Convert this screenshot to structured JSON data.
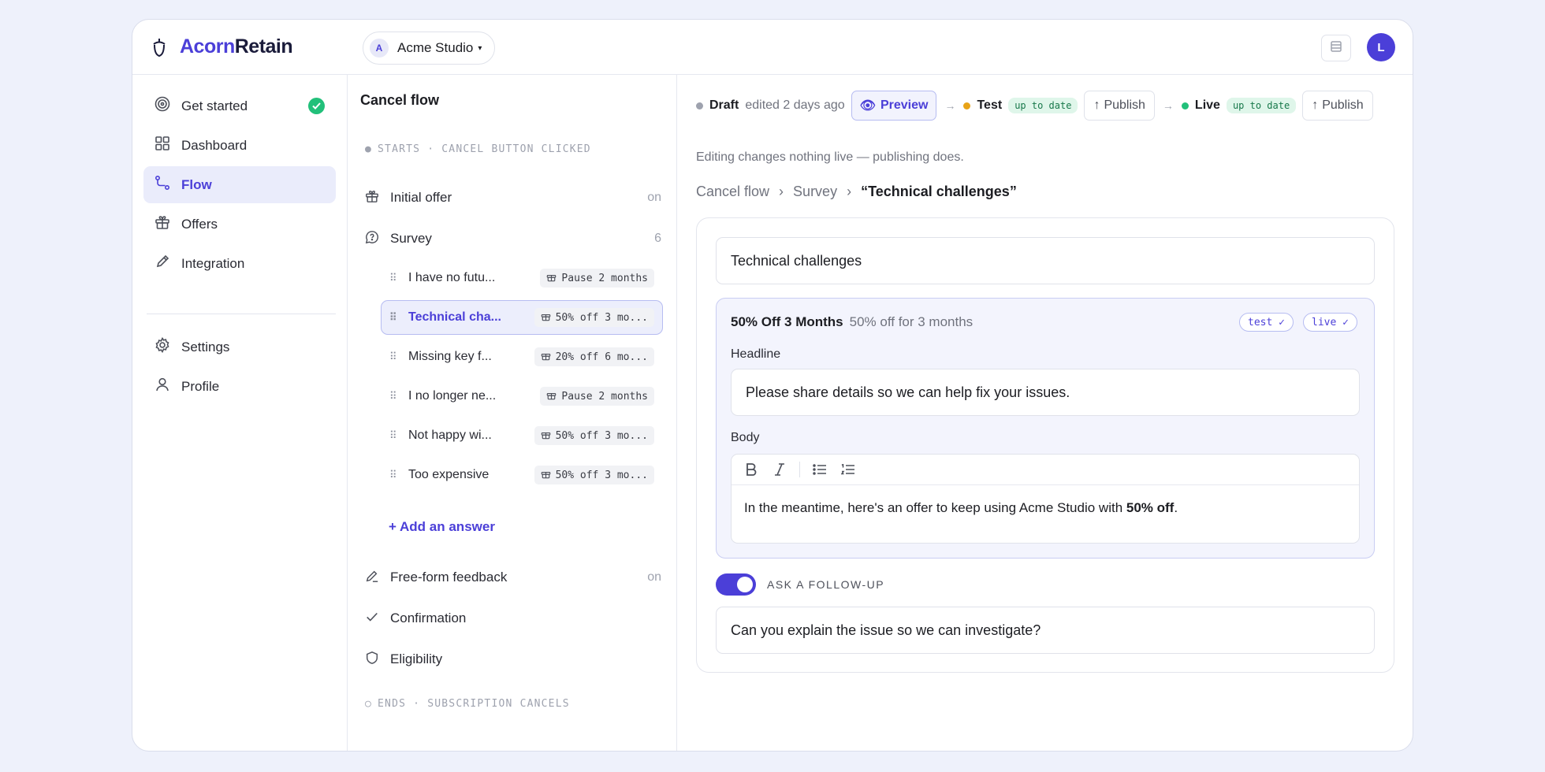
{
  "header": {
    "logo_part1": "Acorn",
    "logo_part2": "Retain",
    "workspace_initial": "A",
    "workspace_name": "Acme Studio",
    "user_initial": "L"
  },
  "sidebar": {
    "items": [
      {
        "label": "Get started",
        "icon": "target-icon",
        "completed": true
      },
      {
        "label": "Dashboard",
        "icon": "grid-icon"
      },
      {
        "label": "Flow",
        "icon": "flow-icon",
        "active": true
      },
      {
        "label": "Offers",
        "icon": "gift-icon"
      },
      {
        "label": "Integration",
        "icon": "pen-icon"
      },
      {
        "label": "Settings",
        "icon": "gear-icon"
      },
      {
        "label": "Profile",
        "icon": "user-icon"
      }
    ]
  },
  "flow": {
    "title": "Cancel flow",
    "start_marker": "STARTS · CANCEL BUTTON CLICKED",
    "end_marker": "ENDS · SUBSCRIPTION CANCELS",
    "steps": {
      "initial_offer": {
        "label": "Initial offer",
        "meta": "on"
      },
      "survey": {
        "label": "Survey",
        "meta": "6"
      },
      "freeform": {
        "label": "Free-form feedback",
        "meta": "on"
      },
      "confirmation": {
        "label": "Confirmation"
      },
      "eligibility": {
        "label": "Eligibility"
      }
    },
    "answers": [
      {
        "label": "I have no futu...",
        "offer": "Pause 2 months"
      },
      {
        "label": "Technical cha...",
        "offer": "50% off 3 mo...",
        "active": true
      },
      {
        "label": "Missing key f...",
        "offer": "20% off 6 mo..."
      },
      {
        "label": "I no longer ne...",
        "offer": "Pause 2 months"
      },
      {
        "label": "Not happy wi...",
        "offer": "50% off 3 mo..."
      },
      {
        "label": "Too expensive",
        "offer": "50% off 3 mo..."
      }
    ],
    "add_answer": "+ Add an answer"
  },
  "status": {
    "draft_label": "Draft",
    "draft_meta": "edited 2 days ago",
    "preview_label": "Preview",
    "test_label": "Test",
    "test_tag": "up to date",
    "live_label": "Live",
    "live_tag": "up to date",
    "publish_label": "Publish",
    "note": "Editing changes nothing live — publishing does.",
    "colors": {
      "draft": "#9ea2ae",
      "test": "#e8a317",
      "live": "#22c07a",
      "accent": "#4b3fd8"
    }
  },
  "breadcrumb": {
    "root": "Cancel flow",
    "parent": "Survey",
    "current": "“Technical challenges”"
  },
  "answer_editor": {
    "answer_text": "Technical challenges",
    "offer": {
      "name": "50% Off 3 Months",
      "description": "50% off for 3 months",
      "badges": [
        "test ✓",
        "live ✓"
      ],
      "headline_label": "Headline",
      "headline_value": "Please share details so we can help fix your issues.",
      "body_label": "Body",
      "body_text_before": "In the meantime, here's an offer to keep using Acme Studio with ",
      "body_text_bold": "50% off",
      "body_text_after": "."
    },
    "follow_up": {
      "label": "ASK A FOLLOW-UP",
      "enabled": true,
      "question": "Can you explain the issue so we can investigate?"
    }
  }
}
